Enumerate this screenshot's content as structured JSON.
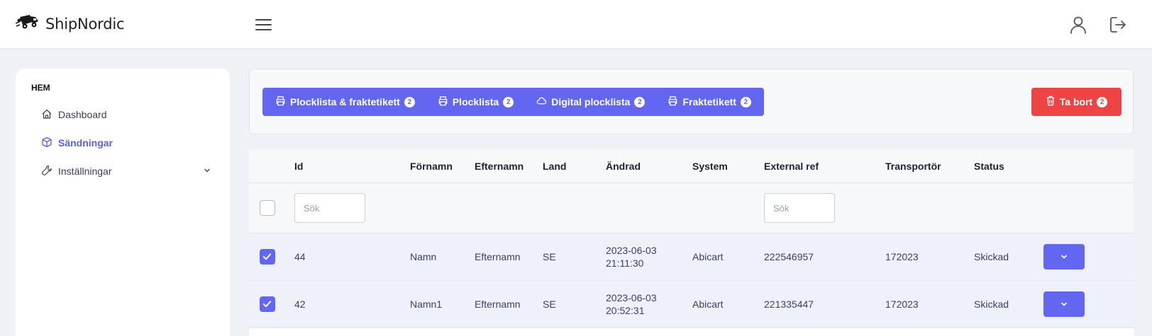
{
  "header": {
    "brand": "ShipNordic",
    "icons": {
      "logo": "delivery-truck-icon",
      "menu": "hamburger-menu-icon",
      "user": "user-icon",
      "logout": "logout-icon"
    }
  },
  "sidebar": {
    "section_title": "HEM",
    "items": [
      {
        "label": "Dashboard",
        "icon": "home-icon",
        "active": false
      },
      {
        "label": "Sändningar",
        "icon": "box-icon",
        "active": true
      },
      {
        "label": "Inställningar",
        "icon": "wrench-icon",
        "active": false,
        "expandable": true
      }
    ]
  },
  "toolbar": {
    "buttons": [
      {
        "label": "Plocklista & fraktetikett",
        "icon": "printer-icon",
        "count": "2"
      },
      {
        "label": "Plocklista",
        "icon": "printer-icon",
        "count": "2"
      },
      {
        "label": "Digital plocklista",
        "icon": "cloud-icon",
        "count": "2"
      },
      {
        "label": "Fraktetikett",
        "icon": "printer-icon",
        "count": "2"
      }
    ],
    "delete": {
      "label": "Ta bort",
      "icon": "trash-icon",
      "count": "2"
    }
  },
  "table": {
    "columns": [
      "Id",
      "Förnamn",
      "Efternamn",
      "Land",
      "Ändrad",
      "System",
      "External ref",
      "Transportör",
      "Status"
    ],
    "filters": {
      "id_placeholder": "Sök",
      "external_ref_placeholder": "Sök"
    },
    "rows": [
      {
        "checked": true,
        "id": "44",
        "first_name": "Namn",
        "last_name": "Efternamn",
        "country": "SE",
        "changed_date": "2023-06-03",
        "changed_time": "21:11:30",
        "system": "Abicart",
        "external_ref": "222546957",
        "carrier": "172023",
        "status": "Skickad"
      },
      {
        "checked": true,
        "id": "42",
        "first_name": "Namn1",
        "last_name": "Efternamn",
        "country": "SE",
        "changed_date": "2023-06-03",
        "changed_time": "20:52:31",
        "system": "Abicart",
        "external_ref": "221335447",
        "carrier": "172023",
        "status": "Skickad"
      }
    ]
  },
  "colors": {
    "accent": "#6366f1",
    "danger": "#ef4444",
    "row_selected": "#eef0fa",
    "background": "#eef1f6"
  }
}
